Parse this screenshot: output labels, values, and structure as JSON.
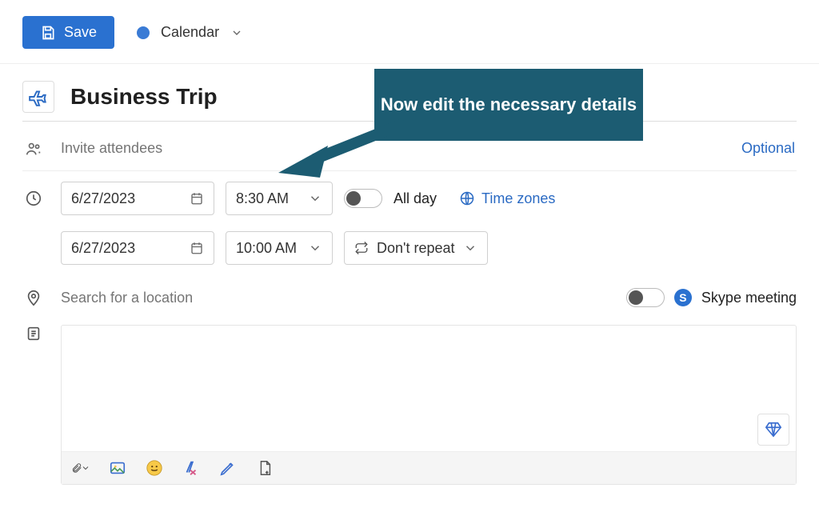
{
  "toolbar": {
    "save_label": "Save",
    "calendar_label": "Calendar"
  },
  "event": {
    "title_value": "Business Trip",
    "attendees_placeholder": "Invite attendees",
    "optional_label": "Optional",
    "start_date": "6/27/2023",
    "start_time": "8:30 AM",
    "end_date": "6/27/2023",
    "end_time": "10:00 AM",
    "all_day_label": "All day",
    "time_zones_label": "Time zones",
    "repeat_label": "Don't repeat",
    "location_placeholder": "Search for a location",
    "skype_label": "Skype meeting"
  },
  "callout": {
    "text": "Now edit the necessary details"
  }
}
